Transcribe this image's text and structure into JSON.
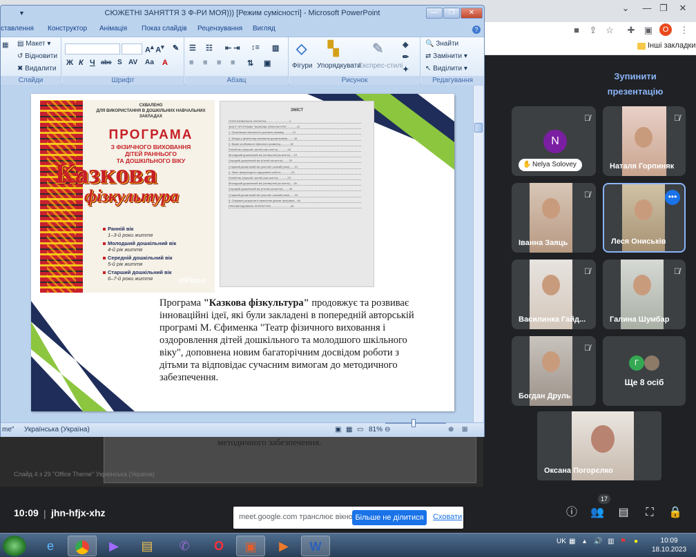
{
  "chrome": {
    "profile_initial": "О",
    "bookmarks_label": "Інші закладки"
  },
  "meet": {
    "stop_presenting": "Зупинити презентацію",
    "participants": [
      {
        "name": "Nelya Solovey",
        "avatar_initial": "N",
        "color": "#7b1fa2"
      },
      {
        "name": "Наталя Горпиняк"
      },
      {
        "name": "Іванна Заяць"
      },
      {
        "name": "Леся Ониськів"
      },
      {
        "name": "Василинка Гайд..."
      },
      {
        "name": "Галина Шумбар"
      },
      {
        "name": "Богдан Друль"
      },
      {
        "name": "Ще 8 осіб",
        "avatar_initial": "Г"
      },
      {
        "name": "Оксана Погорєлко"
      }
    ],
    "time": "10:09",
    "separator": "|",
    "meeting_code": "jhn-hfjx-xhz",
    "people_count": "17",
    "banner": {
      "text": "meet.google.com транслює вікно.",
      "stop_label": "Більше не ділитися",
      "hide_label": "Сховати"
    }
  },
  "ppt": {
    "title": "СЮЖЕТНІ ЗАНЯТТЯ З Ф-РИ МОЯ))) [Режим сумісності] - Microsoft PowerPoint",
    "tabs": [
      "ставлення",
      "Конструктор",
      "Анімація",
      "Показ слайдів",
      "Рецензування",
      "Вигляд"
    ],
    "ribbon": {
      "slides_group": "Слайди",
      "layout": "Макет",
      "reset": "Відновити",
      "delete": "Видалити",
      "font_group": "Шрифт",
      "paragraph_group": "Абзац",
      "drawing_group": "Рисунок",
      "shapes": "Фігури",
      "arrange": "Упорядкувати",
      "quick_styles": "Експрес-стилі",
      "editing_group": "Редагування",
      "find": "Знайти",
      "replace": "Замінити",
      "select": "Виділити"
    },
    "status": {
      "theme": "me\"",
      "language": "Українська (Україна)",
      "zoom": "81%"
    },
    "slide": {
      "cover": {
        "approved": "СХВАЛЕНО",
        "approved_sub": "ДЛЯ ВИКОРИСТАННЯ В ДОШКІЛЬНИХ НАВЧАЛЬНИХ ЗАКЛАДАХ",
        "program": "ПРОГРАМА",
        "subtitle1": "З ФІЗИЧНОГО ВИХОВАННЯ",
        "subtitle2": "ДІТЕЙ РАННЬОГО",
        "subtitle3": "ТА ДОШКІЛЬНОГО ВІКУ",
        "big1": "Казкова",
        "big2": "фізкультура",
        "ages": [
          {
            "title": "Ранній вік",
            "range": "1–3-й роки життя"
          },
          {
            "title": "Молодший дошкільний вік",
            "range": "4-й рік життя"
          },
          {
            "title": "Середній дошкільний вік",
            "range": "5-й рік життя"
          },
          {
            "title": "Старший дошкільний вік",
            "range": "6–7-й роки життя"
          }
        ],
        "publisher": "inPleno"
      },
      "contents": {
        "title": "ЗМІСТ",
        "lines": [
          "ПОЯСНЮВАЛЬНА ЗАПИСКА..............................4",
          "ЗМІСТ ПРОГРАМИ \"КАЗКОВА ФІЗКУЛЬТУРА\".............12",
          "1. Організація загального рухового режиму............12",
          "2. Бесіди у фізичному вихованні дошкільників.........16",
          "3. Вікові особливості фізичного розвитку.............18",
          "   Ранній вік (перший–третій роки життя).............18",
          "   Молодший дошкільний вік (четвертий рік життя).....19",
          "   Середній дошкільний вік (п'ятий рік життя)........20",
          "   Старший дошкільний вік (шостий–сьомий роки).......21",
          "4. Зміст фізкультурно-оздоровчої роботи..............23",
          "   Ранній вік (перший–третій роки життя).............23",
          "   Молодший дошкільний вік (четвертий рік життя).....26",
          "   Середній дошкільний вік (п'ятий рік життя)........28",
          "   Старший дошкільний вік (шостий–сьомий роки).......33",
          "5. Очікувані результати засвоєння дітьми програми....46",
          "РЕКОМЕНДОВАНА ЛІТЕРАТУРА..........................49"
        ]
      },
      "text_before": "Програма ",
      "text_bold": "\"Казкова фізкультура\"",
      "text_after": " продовжує та розвиває інноваційні ідеї, які були закладені в попередній авторській програмі М. Єфименка \"Театр фізичного виховання і оздоровлення дітей дошкільного та молодшого шкільного віку\", доповнена новим багаторічним досвідом роботи з дітьми та відповідає сучасним вимогам до методичного забезпечення."
    }
  },
  "background_ppt": {
    "text": "методичного забезпечення.",
    "status": "Слайд 4 з 29   \"Office Theme\"   Українська (Україна)"
  },
  "taskbar": {
    "lang": "UK",
    "time": "10:09",
    "date": "18.10.2023"
  }
}
